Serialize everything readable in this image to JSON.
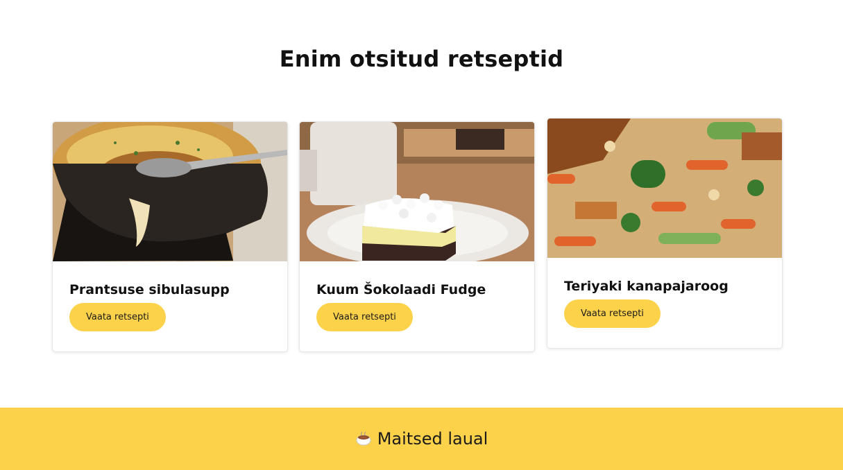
{
  "section": {
    "title": "Enim otsitud retseptid"
  },
  "recipes": [
    {
      "title": "Prantsuse sibulasupp",
      "button_label": "Vaata retsepti",
      "image_icon": "onion-soup-photo"
    },
    {
      "title": "Kuum Šokolaadi Fudge",
      "button_label": "Vaata retsepti",
      "image_icon": "fudge-photo"
    },
    {
      "title": "Teriyaki kanapajaroog",
      "button_label": "Vaata retsepti",
      "image_icon": "teriyaki-photo"
    }
  ],
  "footer": {
    "text": "Maitsed laual",
    "icon": "hot-beverage-icon"
  },
  "colors": {
    "accent": "#fdd24b",
    "background": "#ffffff",
    "text": "#111111"
  }
}
